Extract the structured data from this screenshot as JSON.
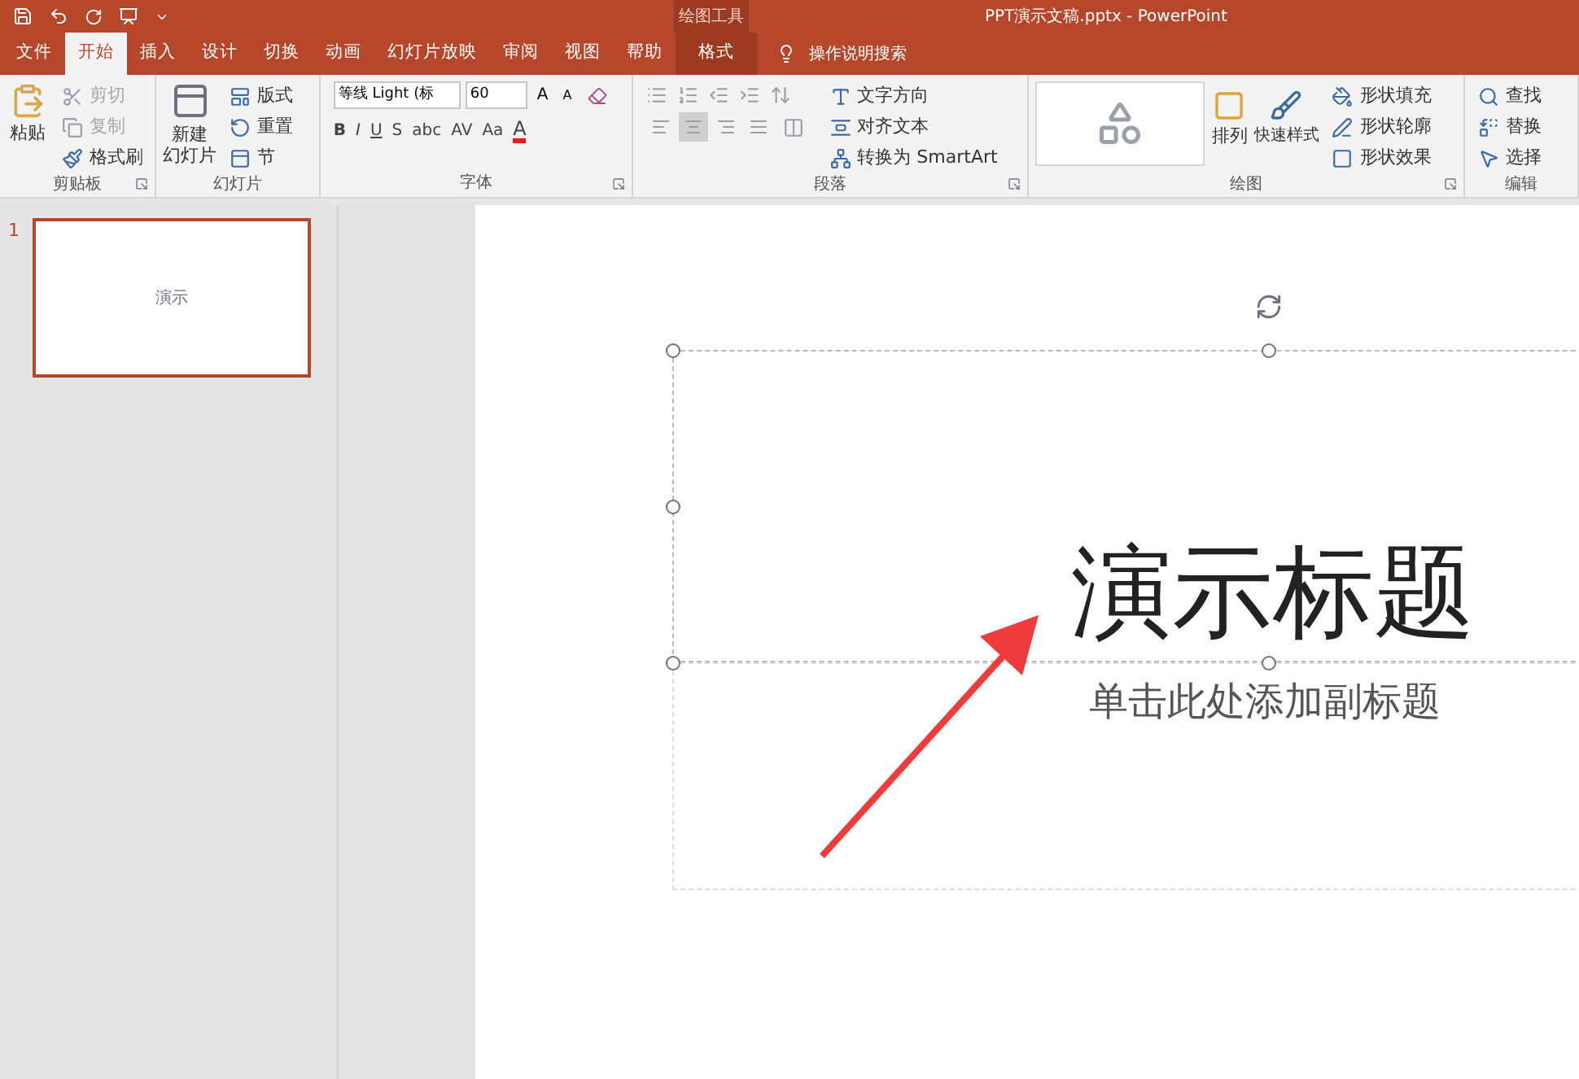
{
  "title_bar": {
    "contextual_label": "绘图工具",
    "title": "PPT演示文稿.pptx  -  PowerPoint"
  },
  "tabs": [
    {
      "label": "文件",
      "kind": "normal",
      "selected": false
    },
    {
      "label": "开始",
      "kind": "normal",
      "selected": true
    },
    {
      "label": "插入",
      "kind": "normal",
      "selected": false
    },
    {
      "label": "设计",
      "kind": "normal",
      "selected": false
    },
    {
      "label": "切换",
      "kind": "normal",
      "selected": false
    },
    {
      "label": "动画",
      "kind": "normal",
      "selected": false
    },
    {
      "label": "幻灯片放映",
      "kind": "normal",
      "selected": false
    },
    {
      "label": "审阅",
      "kind": "normal",
      "selected": false
    },
    {
      "label": "视图",
      "kind": "normal",
      "selected": false
    },
    {
      "label": "帮助",
      "kind": "normal",
      "selected": false
    },
    {
      "label": "格式",
      "kind": "contextual",
      "selected": false
    }
  ],
  "tell_me": {
    "placeholder": "操作说明搜索"
  },
  "clipboard": {
    "label": "剪贴板",
    "paste": "粘贴",
    "items": [
      {
        "label": "剪切",
        "disabled": true
      },
      {
        "label": "复制",
        "disabled": true
      },
      {
        "label": "格式刷",
        "disabled": false
      }
    ]
  },
  "slides_group": {
    "label": "幻灯片",
    "new_slide": [
      "新建",
      "幻灯片"
    ],
    "items": [
      "版式",
      "重置",
      "节"
    ]
  },
  "font": {
    "label": "字体",
    "font_name": "等线 Light (标",
    "font_size": "60",
    "grow": "A",
    "shrink": "A",
    "buttons": [
      "B",
      "I",
      "U",
      "S",
      "abc",
      "AV",
      "Aa"
    ],
    "color_button": "A"
  },
  "paragraph": {
    "label": "段落",
    "alignments": [
      {
        "selected": false
      },
      {
        "selected": true
      },
      {
        "selected": false
      },
      {
        "selected": false
      }
    ],
    "items": [
      "文字方向",
      "对齐文本",
      "转换为 SmartArt"
    ]
  },
  "drawing": {
    "label": "绘图",
    "arrange": "排列",
    "quick_styles": "快速样式",
    "items": [
      "形状填充",
      "形状轮廓",
      "形状效果"
    ]
  },
  "editing": {
    "label": "编辑",
    "items": [
      "查找",
      "替换",
      "选择"
    ]
  },
  "thumbnails": [
    {
      "number": "1",
      "text": "演示",
      "selected": true
    }
  ],
  "slide": {
    "title": "演示标题",
    "subtitle": "单击此处添加副标题"
  }
}
